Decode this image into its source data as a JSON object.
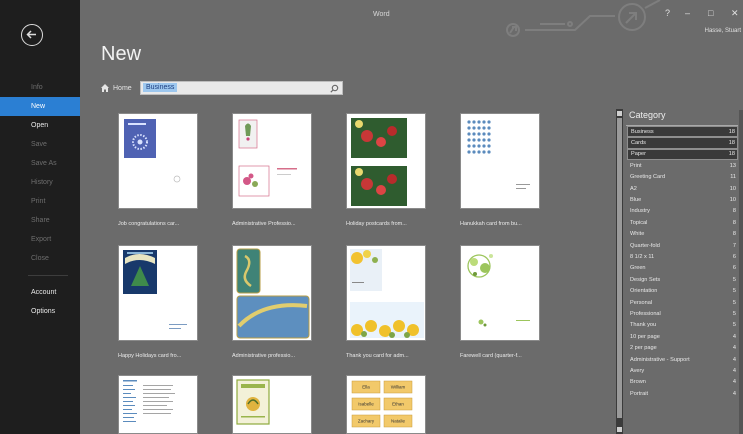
{
  "window": {
    "title": "Word",
    "help_label": "?",
    "minimize_label": "–",
    "maximize_label": "□",
    "close_label": "✕",
    "user": "Hasse, Stuart"
  },
  "nav": {
    "items": [
      {
        "label": "Info",
        "state": "dim"
      },
      {
        "label": "New",
        "state": "active"
      },
      {
        "label": "Open",
        "state": "strong"
      },
      {
        "label": "Save",
        "state": "dim"
      },
      {
        "label": "Save As",
        "state": "dim"
      },
      {
        "label": "History",
        "state": "dim"
      },
      {
        "label": "Print",
        "state": "dim"
      },
      {
        "label": "Share",
        "state": "dim"
      },
      {
        "label": "Export",
        "state": "dim"
      },
      {
        "label": "Close",
        "state": "dim"
      }
    ],
    "bottom_items": [
      {
        "label": "Account"
      },
      {
        "label": "Options"
      }
    ]
  },
  "main": {
    "heading": "New",
    "home_label": "Home",
    "search_value": "Business"
  },
  "templates": [
    {
      "label": "Job congratulations car..."
    },
    {
      "label": "Administrative Professio..."
    },
    {
      "label": "Holiday postcards from..."
    },
    {
      "label": "Hanukkah card from bu..."
    },
    {
      "label": "Happy Holidays card fro..."
    },
    {
      "label": "Administrative professio..."
    },
    {
      "label": "Thank you card for adm..."
    },
    {
      "label": "Farewell card (quarter-f..."
    },
    {
      "label": ""
    },
    {
      "label": ""
    },
    {
      "label": "",
      "tags": [
        "Ella",
        "William",
        "Isabelle",
        "Ethan",
        "Zachary",
        "Natalie"
      ]
    }
  ],
  "category_panel": {
    "title": "Category",
    "items": [
      {
        "name": "Business",
        "count": "18",
        "selected": true
      },
      {
        "name": "Cards",
        "count": "18",
        "selected": true
      },
      {
        "name": "Paper",
        "count": "18",
        "selected": true
      },
      {
        "name": "Print",
        "count": "13"
      },
      {
        "name": "Greeting Card",
        "count": "11"
      },
      {
        "name": "A2",
        "count": "10"
      },
      {
        "name": "Blue",
        "count": "10"
      },
      {
        "name": "Industry",
        "count": "8"
      },
      {
        "name": "Topical",
        "count": "8"
      },
      {
        "name": "White",
        "count": "8"
      },
      {
        "name": "Quarter-fold",
        "count": "7"
      },
      {
        "name": "8 1/2 x 11",
        "count": "6"
      },
      {
        "name": "Green",
        "count": "6"
      },
      {
        "name": "Design Sets",
        "count": "5"
      },
      {
        "name": "Orientation",
        "count": "5"
      },
      {
        "name": "Personal",
        "count": "5"
      },
      {
        "name": "Professional",
        "count": "5"
      },
      {
        "name": "Thank you",
        "count": "5"
      },
      {
        "name": "10 per page",
        "count": "4"
      },
      {
        "name": "2 per page",
        "count": "4"
      },
      {
        "name": "Administrative - Support",
        "count": "4"
      },
      {
        "name": "Avery",
        "count": "4"
      },
      {
        "name": "Brown",
        "count": "4"
      },
      {
        "name": "Portrait",
        "count": "4"
      }
    ]
  },
  "colors": {
    "sidebar": "#1e1e1e",
    "accent": "#2b7fd3",
    "background": "#6b6b6b"
  }
}
